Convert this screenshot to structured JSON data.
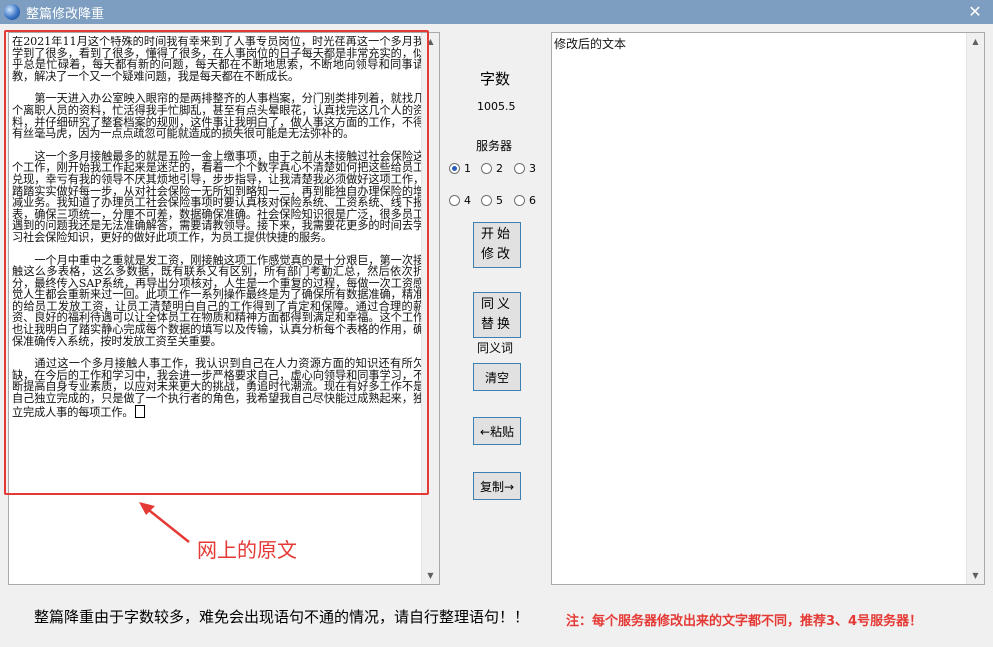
{
  "window": {
    "title": "整篇修改降重"
  },
  "original": {
    "paragraphs": [
      "在2021年11月这个特殊的时间我有幸来到了人事专员岗位，时光荏苒这一个多月我学到了很多，看到了很多，懂得了很多，在人事岗位的日子每天都是非常充实的，似乎总是忙碌着，每天都有新的问题，每天都在不断地思索，不断地向领导和同事请教，解决了一个又一个疑难问题，我是每天都在不断成长。",
      "第一天进入办公室映入眼帘的是两排整齐的人事档案，分门别类排列着，就找几个离职人员的资料，忙活得我手忙脚乱，甚至有点头晕眼花，认真找完这几个人的资料，并仔细研究了整套档案的规则，这件事让我明白了，做人事这方面的工作，不得有丝毫马虎，因为一点点疏忽可能就造成的损失很可能是无法弥补的。",
      "这一个多月接触最多的就是五险一金上缴事项，由于之前从未接触过社会保险这个工作，刚开始我工作起来是迷茫的，看着一个个数字真心不清楚如何把这些给员工兑现，幸亏有我的领导不厌其烦地引导，步步指导，让我清楚我必须做好这项工作，踏踏实实做好每一步，从对社会保险一无所知到略知一二，再到能独自办理保险的增减业务。我知道了办理员工社会保险事项时要认真核对保险系统、工资系统、线下报表，确保三项统一，分厘不可差，数据确保准确。社会保险知识很是广泛，很多员工遇到的问题我还是无法准确解答，需要请教领导。接下来，我需要花更多的时间去学习社会保险知识，更好的做好此项工作，为员工提供快捷的服务。",
      "一个月中重中之重就是发工资，刚接触这项工作感觉真的是十分艰巨，第一次接触这么多表格，这么多数据，既有联系又有区别，所有部门考勤汇总，然后依次折分，最终传入SAP系统，再导出分项核对，人生是一个重复的过程，每做一次工资感觉人生都会重新来过一回。此项工作一系列操作最终是为了确保所有数据准确，精准的给员工发放工资，让员工清楚明白自己的工作得到了肯定和保障。通过合理的薪资、良好的福利待遇可以让全体员工在物质和精神方面都得到满足和幸福。这个工作也让我明白了踏实静心完成每个数据的填写以及传输，认真分析每个表格的作用，确保准确传入系统，按时发放工资至关重要。",
      "通过这一个多月接触人事工作，我认识到自己在人力资源方面的知识还有所欠缺，在今后的工作和学习中，我会进一步严格要求自己，虚心向领导和同事学习，不断提高自身专业素质，以应对未来更大的挑战，勇追时代潮流。现在有好多工作不是自己独立完成的，只是做了一个执行者的角色，我希望我自己尽快能过成熟起来，独立完成人事的每项工作。"
    ]
  },
  "annotation": {
    "callout": "网上的原文"
  },
  "modified": {
    "placeholder": "修改后的文本"
  },
  "controls": {
    "word_count_label": "字数",
    "word_count_value": "1005.5",
    "server_label": "服务器",
    "servers": [
      {
        "label": "1",
        "selected": true
      },
      {
        "label": "2",
        "selected": false
      },
      {
        "label": "3",
        "selected": false
      },
      {
        "label": "4",
        "selected": false
      },
      {
        "label": "5",
        "selected": false
      },
      {
        "label": "6",
        "selected": false
      }
    ],
    "start_button": [
      "开始",
      "修改"
    ],
    "synonym_button": [
      "同义",
      "替换"
    ],
    "synonym_label": "同义词",
    "clear_button": "清空",
    "paste_button": "←粘贴",
    "copy_button": "复制→"
  },
  "footer": {
    "note": "整篇降重由于字数较多，难免会出现语句不通的情况，请自行整理语句！！",
    "warning": "注：每个服务器修改出来的文字都不同，推荐3、4号服务器！"
  },
  "colors": {
    "accent_red": "#e53935",
    "title_bar": "#7d9ec0"
  }
}
